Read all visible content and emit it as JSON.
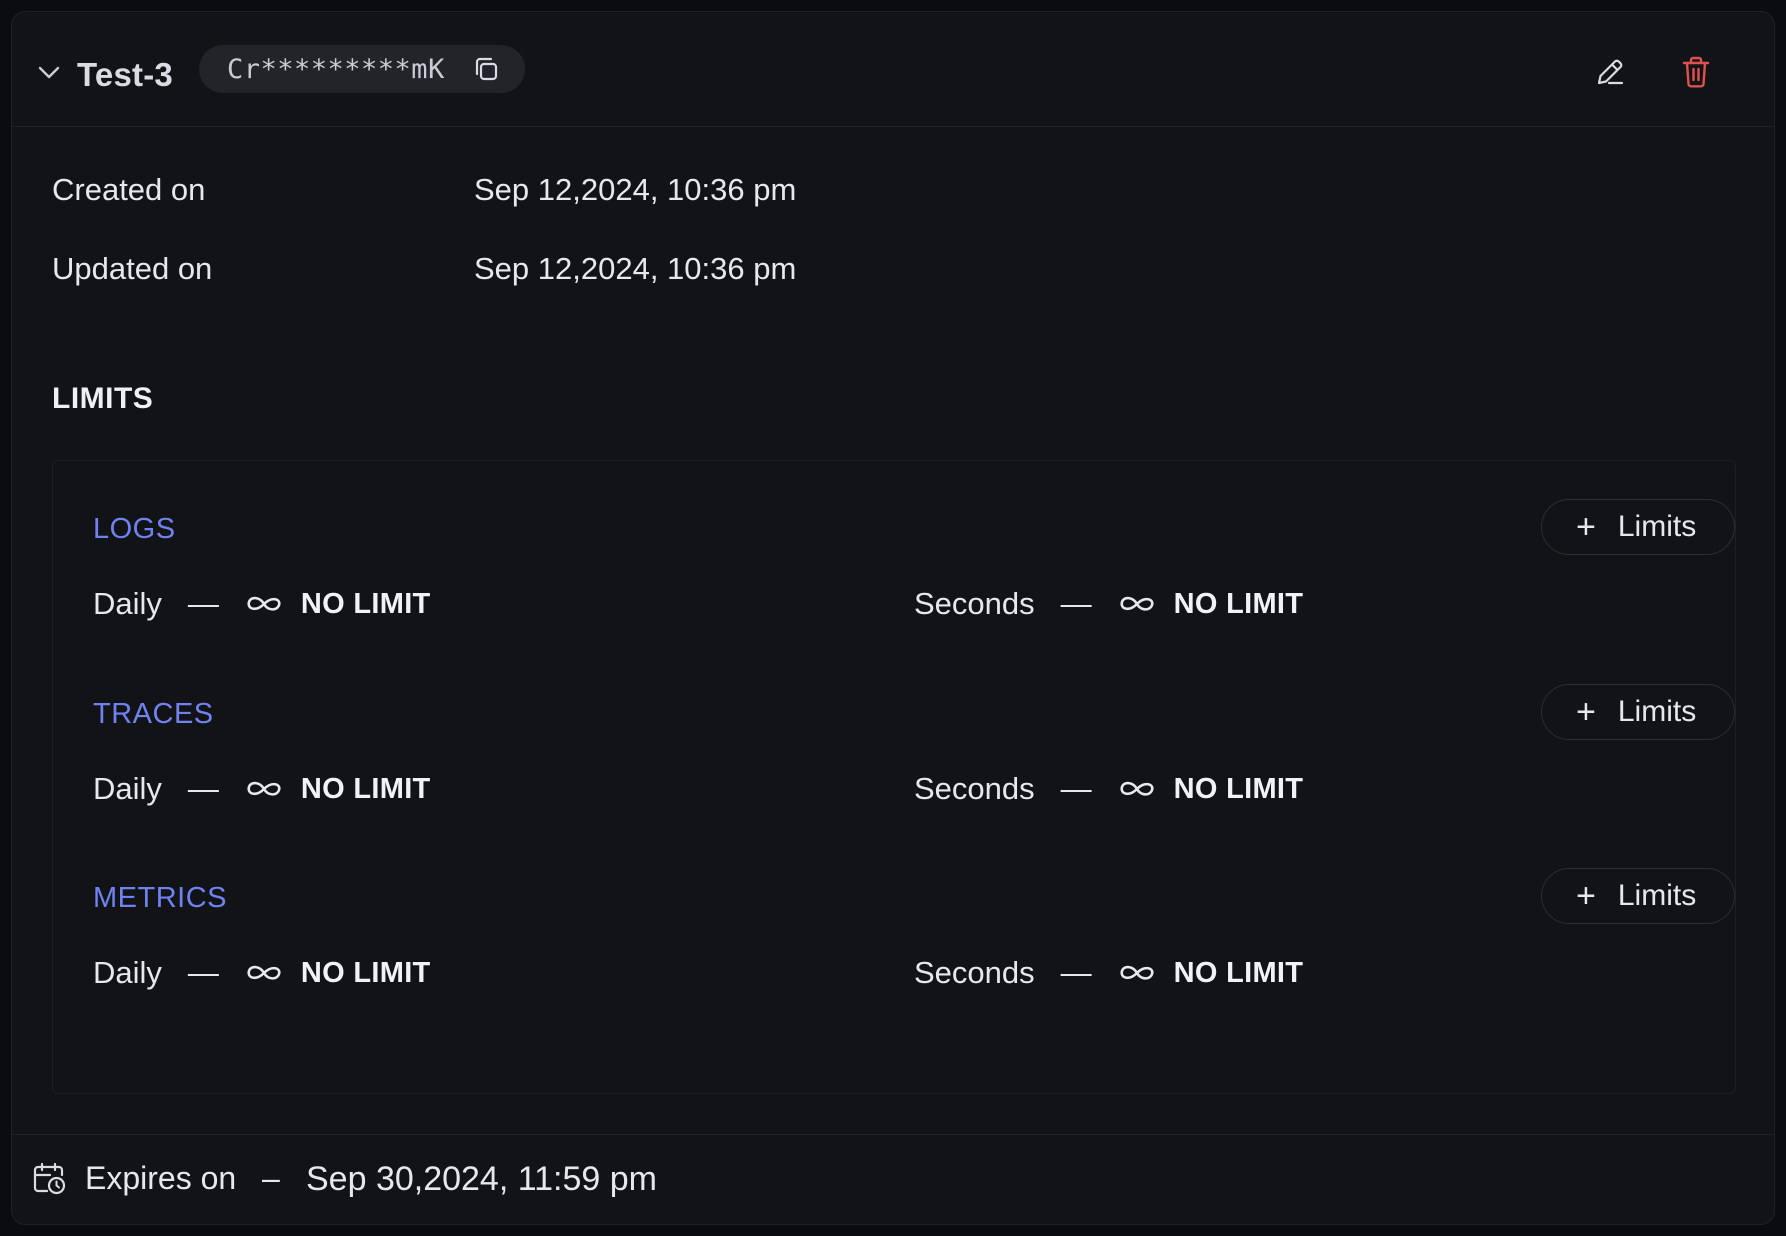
{
  "header": {
    "title": "Test-3",
    "masked_key": "Cr*********mK"
  },
  "meta": [
    {
      "label": "Created on",
      "value": "Sep 12,2024, 10:36 pm"
    },
    {
      "label": "Updated on",
      "value": "Sep 12,2024, 10:36 pm"
    }
  ],
  "limits": {
    "heading": "LIMITS",
    "add_label": "Limits",
    "sections": [
      {
        "title": "LOGS",
        "daily_label": "Daily",
        "daily_value": "NO LIMIT",
        "seconds_label": "Seconds",
        "seconds_value": "NO LIMIT"
      },
      {
        "title": "TRACES",
        "daily_label": "Daily",
        "daily_value": "NO LIMIT",
        "seconds_label": "Seconds",
        "seconds_value": "NO LIMIT"
      },
      {
        "title": "METRICS",
        "daily_label": "Daily",
        "daily_value": "NO LIMIT",
        "seconds_label": "Seconds",
        "seconds_value": "NO LIMIT"
      }
    ],
    "separator": "—"
  },
  "footer": {
    "label": "Expires on",
    "separator": "–",
    "date": "Sep 30,2024, 11:59 pm"
  },
  "colors": {
    "background": "#121317",
    "accent_section": "#6f82f0",
    "delete": "#e0524f"
  },
  "icons": {
    "collapse": "chevron-down-icon",
    "copy": "copy-icon",
    "edit": "pencil-icon",
    "delete": "trash-icon",
    "add": "plus-icon",
    "unlimited": "infinity-icon",
    "expiry": "calendar-clock-icon"
  }
}
